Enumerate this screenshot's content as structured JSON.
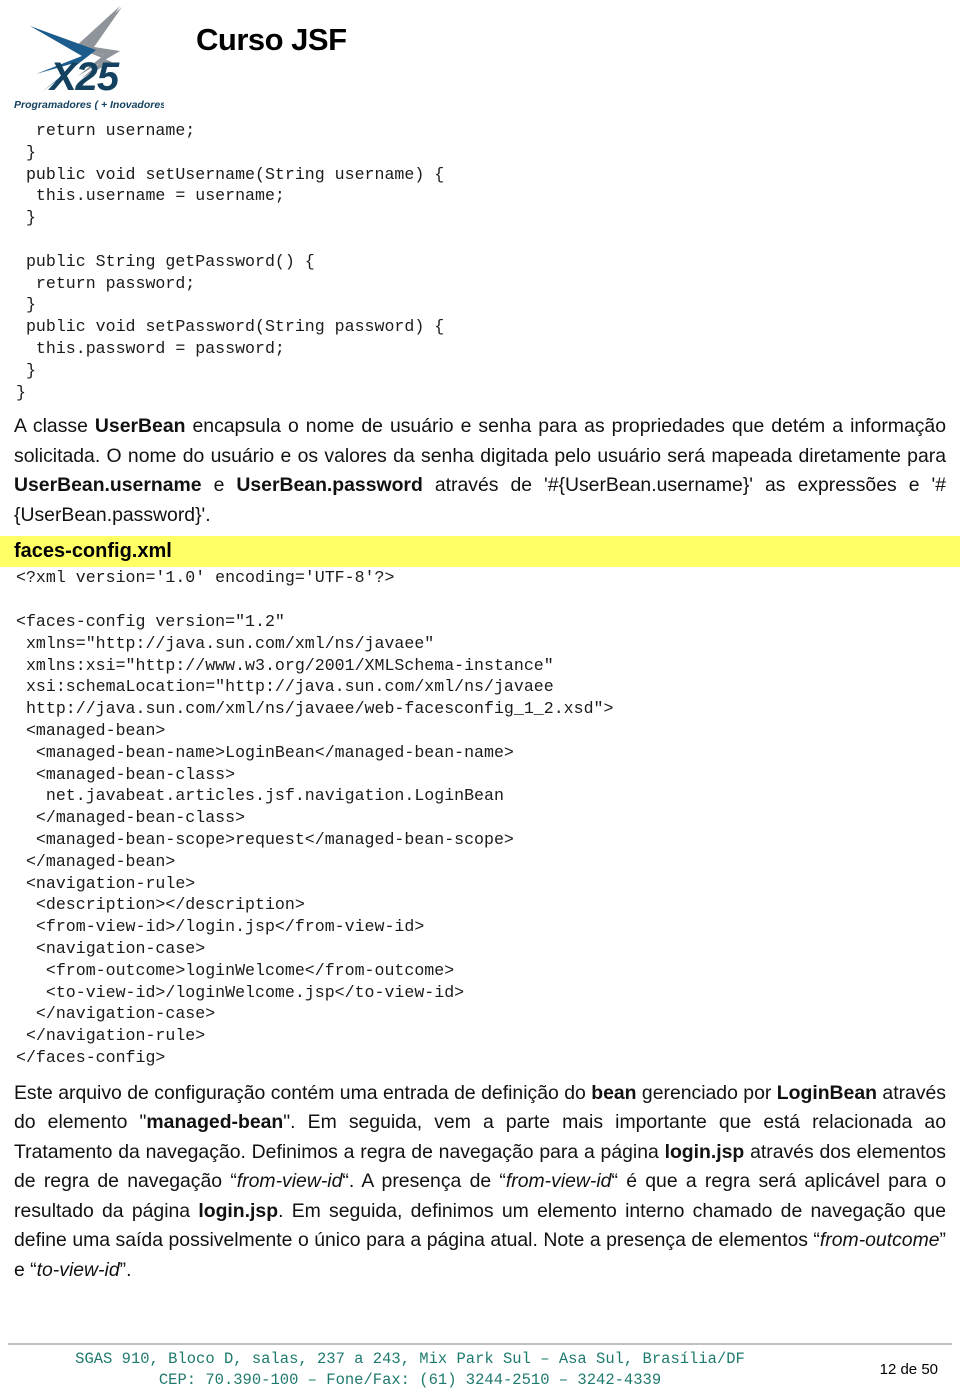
{
  "header": {
    "title": "Curso JSF",
    "logo": {
      "name": "x25-logo",
      "brand_text": "X25",
      "tagline": "Programadores ( + Inovadores ; )",
      "colors": {
        "blue": "#1c5c8c",
        "dark_blue": "#13415f",
        "gray": "#8a8f94"
      }
    }
  },
  "code_java": "  return username;\n }\n public void setUsername(String username) {\n  this.username = username;\n }\n\n public String getPassword() {\n  return password;\n }\n public void setPassword(String password) {\n  this.password = password;\n }\n}",
  "paragraph_top": {
    "segments": [
      {
        "text": "A classe ",
        "style": "normal"
      },
      {
        "text": "UserBean",
        "style": "bold"
      },
      {
        "text": " encapsula o nome de usuário e senha para as propriedades que detém a informação solicitada. O nome do usuário e os valores da senha digitada pelo usuário será mapeada diretamente para ",
        "style": "normal"
      },
      {
        "text": "UserBean.username",
        "style": "bold"
      },
      {
        "text": " e ",
        "style": "normal"
      },
      {
        "text": "UserBean.password",
        "style": "bold"
      },
      {
        "text": " através de '#{UserBean.username}' as expressões e '#{UserBean.password}'.",
        "style": "normal"
      }
    ]
  },
  "section_heading": {
    "label": "faces-config.xml",
    "highlight_color": "#ffff66"
  },
  "code_xml": "<?xml version='1.0' encoding='UTF-8'?>\n\n<faces-config version=\"1.2\"\n xmlns=\"http://java.sun.com/xml/ns/javaee\"\n xmlns:xsi=\"http://www.w3.org/2001/XMLSchema-instance\"\n xsi:schemaLocation=\"http://java.sun.com/xml/ns/javaee\n http://java.sun.com/xml/ns/javaee/web-facesconfig_1_2.xsd\">\n <managed-bean>\n  <managed-bean-name>LoginBean</managed-bean-name>\n  <managed-bean-class>\n   net.javabeat.articles.jsf.navigation.LoginBean\n  </managed-bean-class>\n  <managed-bean-scope>request</managed-bean-scope>\n </managed-bean>\n <navigation-rule>\n  <description></description>\n  <from-view-id>/login.jsp</from-view-id>\n  <navigation-case>\n   <from-outcome>loginWelcome</from-outcome>\n   <to-view-id>/loginWelcome.jsp</to-view-id>\n  </navigation-case>\n </navigation-rule>\n</faces-config>",
  "paragraph_bottom": {
    "segments": [
      {
        "text": "Este arquivo de configuração contém uma entrada de definição do ",
        "style": "normal"
      },
      {
        "text": "bean",
        "style": "bold"
      },
      {
        "text": " gerenciado por ",
        "style": "normal"
      },
      {
        "text": "LoginBean",
        "style": "bold"
      },
      {
        "text": " através do elemento \"",
        "style": "normal"
      },
      {
        "text": "managed-bean",
        "style": "bold"
      },
      {
        "text": "\". Em seguida, vem a parte mais importante que está relacionada ao Tratamento da navegação. Definimos a regra de navegação para a página ",
        "style": "normal"
      },
      {
        "text": "login.jsp",
        "style": "bold"
      },
      {
        "text": " através dos elementos de regra de navegação “",
        "style": "normal"
      },
      {
        "text": "from-view-id",
        "style": "italic"
      },
      {
        "text": "“. A presença de “",
        "style": "normal"
      },
      {
        "text": "from-view-id",
        "style": "italic"
      },
      {
        "text": "“ é que a regra será aplicável para o resultado da página ",
        "style": "normal"
      },
      {
        "text": "login.jsp",
        "style": "bold"
      },
      {
        "text": ". Em seguida, definimos um elemento interno chamado de navegação que define uma saída possivelmente o único para a página atual. Note a presença de elementos “",
        "style": "normal"
      },
      {
        "text": "from-outcome",
        "style": "italic"
      },
      {
        "text": "” e “",
        "style": "normal"
      },
      {
        "text": "to-view-id",
        "style": "italic"
      },
      {
        "text": "”.",
        "style": "normal"
      }
    ]
  },
  "footer": {
    "address_line1": "SGAS 910, Bloco D, salas, 237 a 243, Mix Park Sul – Asa Sul, Brasília/DF",
    "address_line2": "CEP: 70.390-100 – Fone/Fax: (61) 3244-2510 – 3242-4339",
    "address_color": "#1f7a6e",
    "page_number": "12 de 50"
  }
}
